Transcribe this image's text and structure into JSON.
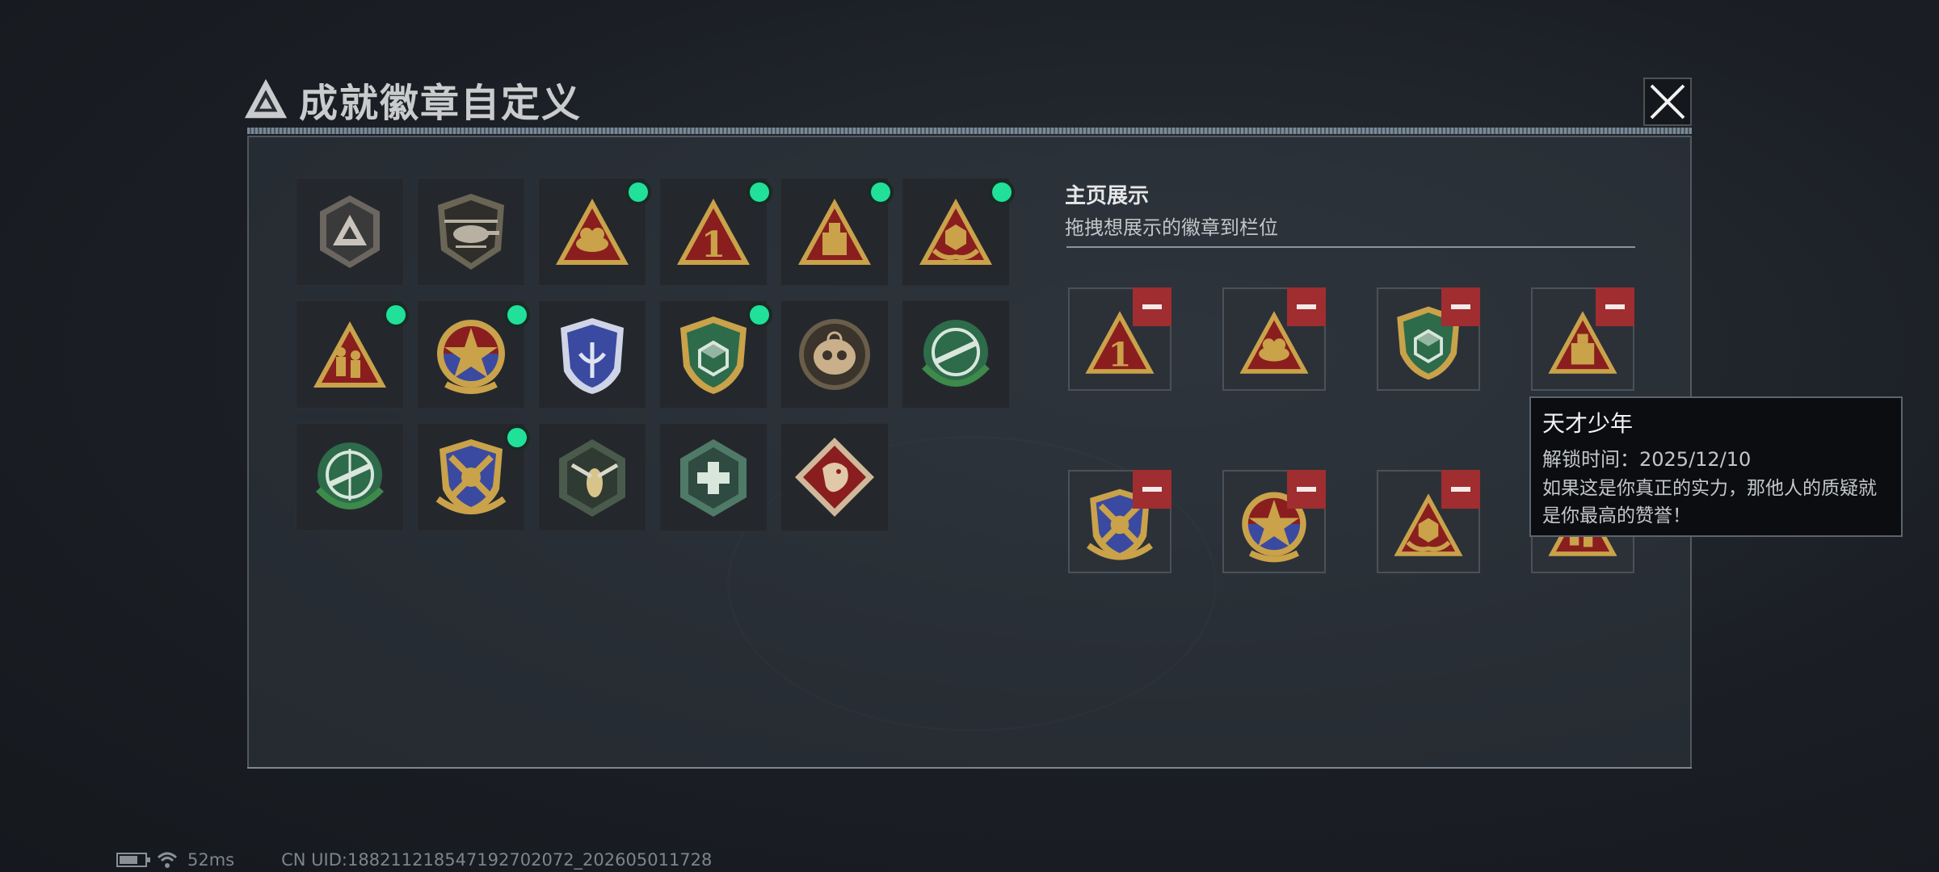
{
  "window": {
    "title": "成就徽章自定义",
    "close_icon": "close-icon"
  },
  "colors": {
    "owned_dot": "#20e09a",
    "remove_button": "#a02d2f",
    "gold": "#c9a24a",
    "red": "#8a1e1e",
    "green": "#2d6b4a"
  },
  "badge_grid": [
    {
      "icon": "triangle-logo-shield-badge",
      "new": false
    },
    {
      "icon": "helicopter-badge",
      "new": false
    },
    {
      "icon": "eagle-triangle-badge",
      "new": true
    },
    {
      "icon": "number-one-triangle-badge",
      "new": true
    },
    {
      "icon": "usb-drive-triangle-badge",
      "new": true
    },
    {
      "icon": "hands-dice-triangle-badge",
      "new": true
    },
    {
      "icon": "soldiers-triangle-badge",
      "new": true
    },
    {
      "icon": "star-emblem-badge",
      "new": true
    },
    {
      "icon": "blue-shield-wings-badge",
      "new": false
    },
    {
      "icon": "green-dice-shield-badge",
      "new": true
    },
    {
      "icon": "skull-crosshair-badge",
      "new": false
    },
    {
      "icon": "green-rifle-crosshair-badge",
      "new": false
    },
    {
      "icon": "green-sniper-crosshair-badge",
      "new": false
    },
    {
      "icon": "gold-crossed-weapons-shield-badge",
      "new": true
    },
    {
      "icon": "wasp-hexagon-badge",
      "new": false
    },
    {
      "icon": "medic-hexagon-badge",
      "new": false
    },
    {
      "icon": "dragon-diamond-badge",
      "new": false
    }
  ],
  "showcase": {
    "title": "主页展示",
    "subtitle": "拖拽想展示的徽章到栏位",
    "slots": [
      {
        "icon": "number-one-triangle-badge"
      },
      {
        "icon": "eagle-triangle-badge"
      },
      {
        "icon": "green-dice-shield-badge"
      },
      {
        "icon": "usb-drive-triangle-badge"
      },
      {
        "icon": "gold-crossed-weapons-shield-badge"
      },
      {
        "icon": "star-emblem-badge"
      },
      {
        "icon": "hands-dice-triangle-badge"
      },
      {
        "icon": "soldiers-triangle-badge"
      }
    ]
  },
  "tooltip": {
    "name": "天才少年",
    "unlock_time": "解锁时间：2025/12/10",
    "description": "如果这是你真正的实力，那他人的质疑就是你最高的赞誉！"
  },
  "status_bar": {
    "ping": "52ms",
    "uid": "CN UID:1882112185471927020​72_202605011728"
  }
}
